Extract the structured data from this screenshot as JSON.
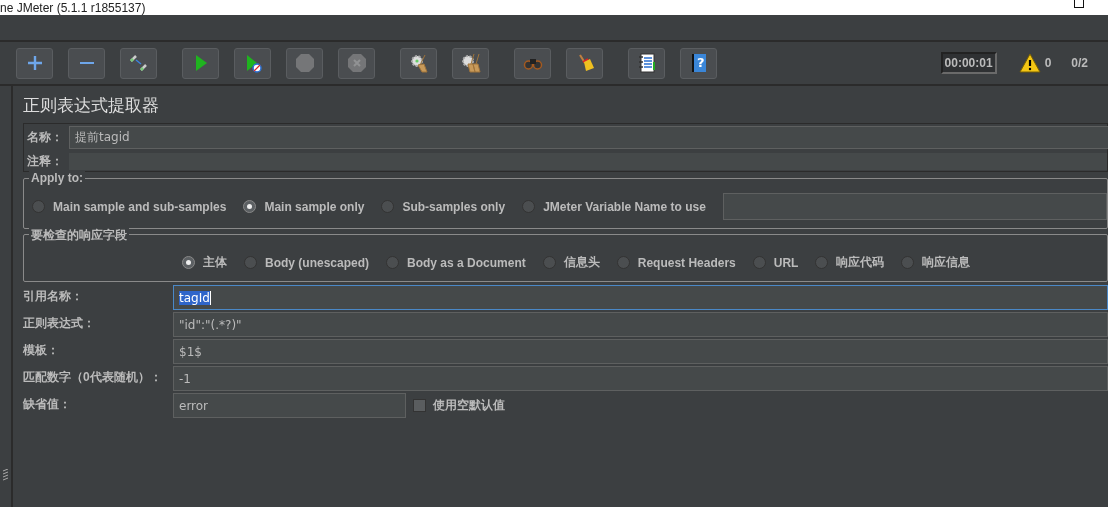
{
  "window": {
    "title": "ne JMeter (5.1.1 r1855137)"
  },
  "toolbar": {
    "groups": [
      [
        {
          "disabled": false
        },
        {
          "disabled": false
        },
        {
          "disabled": false
        }
      ],
      [
        {
          "disabled": false
        },
        {
          "disabled": false
        },
        {
          "disabled": true
        },
        {
          "disabled": true
        }
      ],
      [
        {
          "disabled": false
        },
        {
          "disabled": false
        }
      ],
      [
        {
          "disabled": false
        },
        {
          "disabled": false
        }
      ],
      [
        {
          "disabled": false
        },
        {
          "disabled": false,
          "glyph": "?"
        }
      ]
    ],
    "timer": "00:00:01",
    "warnings": "0",
    "threads": "0/2"
  },
  "extractor": {
    "title": "正则表达式提取器",
    "name": {
      "label": "名称：",
      "value": "提前tagid"
    },
    "comment": {
      "label": "注释："
    },
    "apply_to": {
      "legend": "Apply to:",
      "options": [
        {
          "label": "Main sample and sub-samples",
          "selected": false
        },
        {
          "label": "Main sample only",
          "selected": true
        },
        {
          "label": "Sub-samples only",
          "selected": false
        },
        {
          "label": "JMeter Variable Name to use",
          "selected": false
        }
      ]
    },
    "field_to_check": {
      "legend": "要检查的响应字段",
      "options": [
        {
          "label": "主体",
          "selected": true
        },
        {
          "label": "Body (unescaped)",
          "selected": false
        },
        {
          "label": "Body as a Document",
          "selected": false
        },
        {
          "label": "信息头",
          "selected": false
        },
        {
          "label": "Request Headers",
          "selected": false
        },
        {
          "label": "URL",
          "selected": false
        },
        {
          "label": "响应代码",
          "selected": false
        },
        {
          "label": "响应信息",
          "selected": false
        }
      ]
    },
    "rows": [
      {
        "label": "引用名称：",
        "value": "tagId",
        "focused": true
      },
      {
        "label": "正则表达式：",
        "value": "\"id\":\"(.*?)\"",
        "focused": false
      },
      {
        "label": "模板：",
        "value": "$1$",
        "focused": false
      },
      {
        "label": "匹配数字（0代表随机）：",
        "value": "-1",
        "focused": false
      },
      {
        "label": "缺省值：",
        "value": "error",
        "focused": false,
        "checkbox": {
          "label": "使用空默认值",
          "checked": false
        }
      }
    ]
  }
}
